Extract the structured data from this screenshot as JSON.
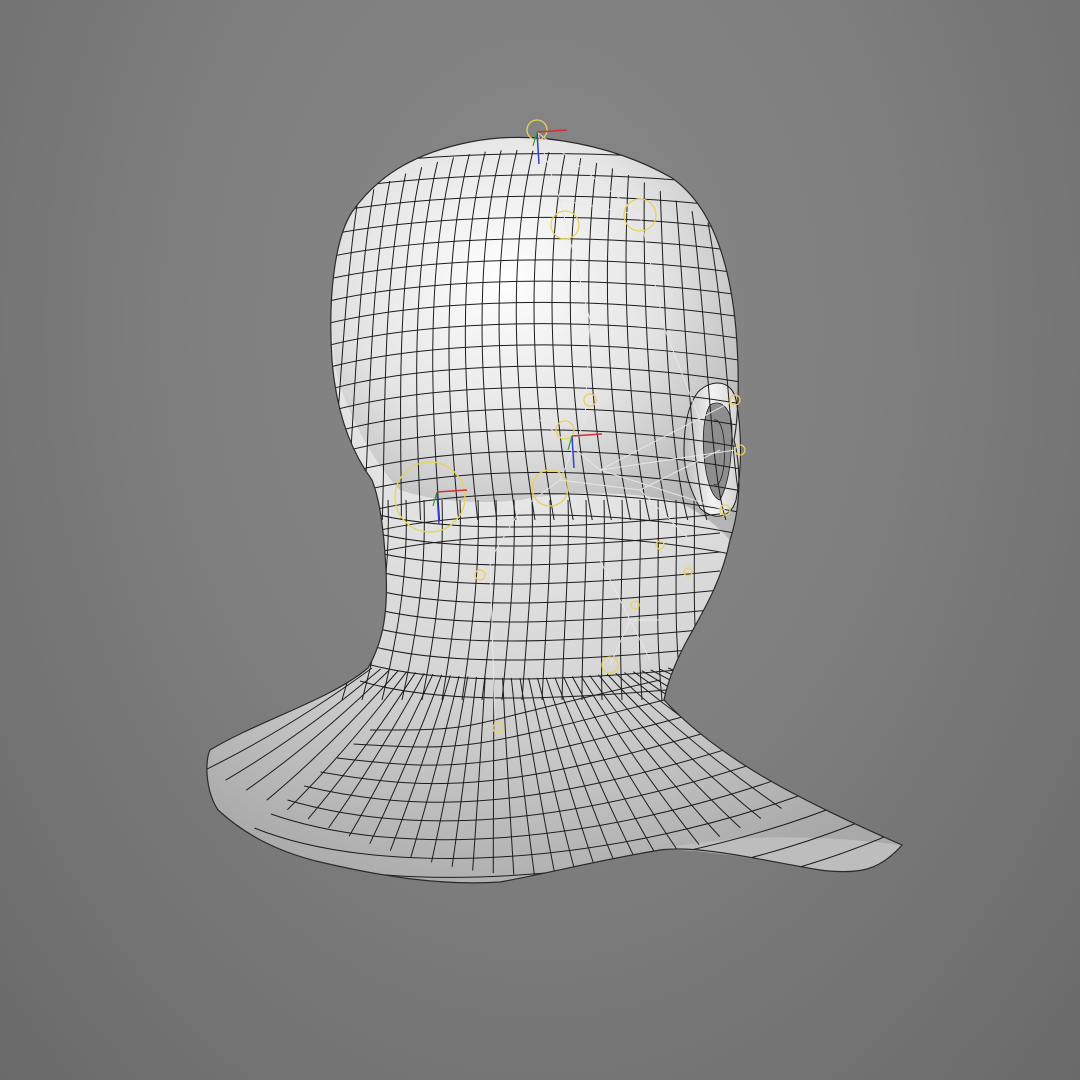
{
  "viewport": {
    "background_color": "#808080",
    "mesh_fill_color": "#d9d9d9",
    "wire_color": "#1c1c1c",
    "rig_color": "#e8e8e8",
    "joint_color": "#e6d35a",
    "axis_x_color": "#d03030",
    "axis_y_color": "#30a030",
    "axis_z_color": "#3040d0"
  },
  "model": {
    "subject": "head-and-neck-bust",
    "view": "rear-three-quarter",
    "display": "shaded-wireframe-with-rig"
  }
}
